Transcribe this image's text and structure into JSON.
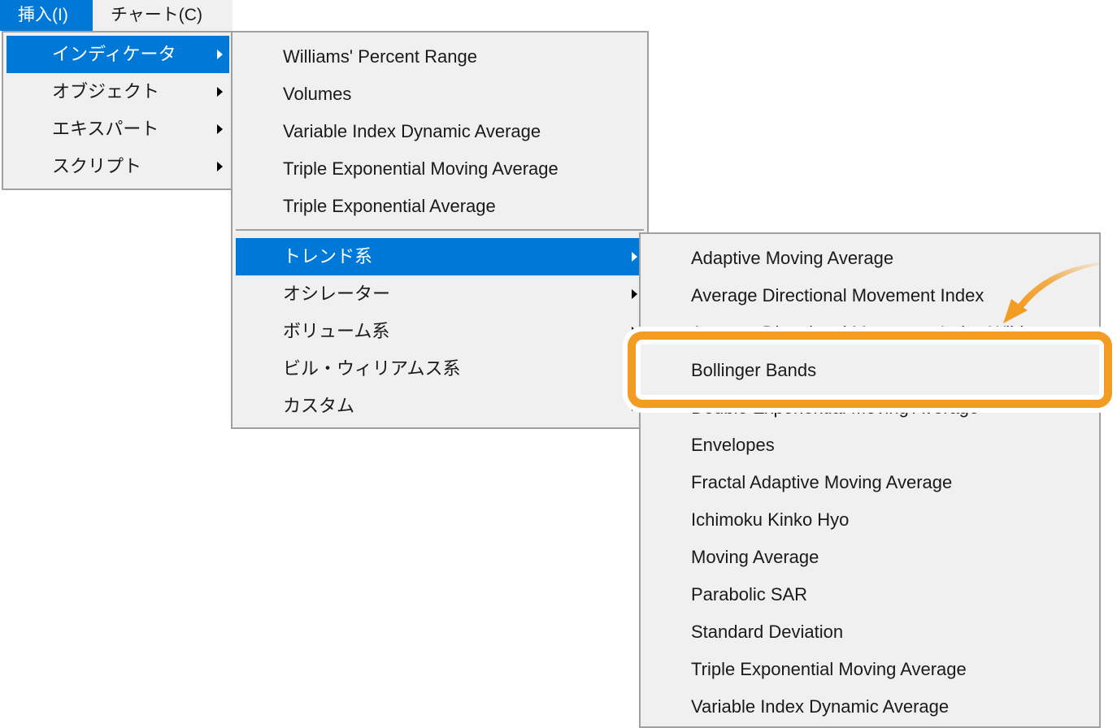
{
  "menubar": {
    "items": [
      {
        "label": "挿入(I)",
        "active": true
      },
      {
        "label": "チャート(C)",
        "active": false
      }
    ]
  },
  "insert_menu": {
    "items": [
      {
        "label": "インディケータ",
        "submenu": true,
        "selected": true
      },
      {
        "label": "オブジェクト",
        "submenu": true,
        "selected": false
      },
      {
        "label": "エキスパート",
        "submenu": true,
        "selected": false
      },
      {
        "label": "スクリプト",
        "submenu": true,
        "selected": false
      }
    ]
  },
  "indicators_menu": {
    "items": [
      {
        "label": "Williams' Percent Range"
      },
      {
        "label": "Volumes"
      },
      {
        "label": "Variable Index Dynamic Average"
      },
      {
        "label": "Triple Exponential Moving Average"
      },
      {
        "label": "Triple Exponential Average"
      }
    ],
    "categories": [
      {
        "label": "トレンド系",
        "submenu": true,
        "selected": true
      },
      {
        "label": "オシレーター",
        "submenu": true,
        "selected": false
      },
      {
        "label": "ボリューム系",
        "submenu": true,
        "selected": false
      },
      {
        "label": "ビル・ウィリアムス系",
        "submenu": true,
        "selected": false
      },
      {
        "label": "カスタム",
        "submenu": true,
        "selected": false
      }
    ]
  },
  "trend_menu": {
    "items": [
      {
        "label": "Adaptive Moving Average"
      },
      {
        "label": "Average Directional Movement Index"
      },
      {
        "label": "Average Directional Movement Index Wilder"
      },
      {
        "label": "Bollinger Bands",
        "highlighted": true
      },
      {
        "label": "Double Exponential Moving Average"
      },
      {
        "label": "Envelopes"
      },
      {
        "label": "Fractal Adaptive Moving Average"
      },
      {
        "label": "Ichimoku Kinko Hyo"
      },
      {
        "label": "Moving Average"
      },
      {
        "label": "Parabolic SAR"
      },
      {
        "label": "Standard Deviation"
      },
      {
        "label": "Triple Exponential Moving Average"
      },
      {
        "label": "Variable Index Dynamic Average"
      }
    ]
  },
  "annotation": {
    "color": "#f39c23",
    "target": "Bollinger Bands"
  },
  "colors": {
    "selection": "#0078d7",
    "menu_bg": "#f0f0f0",
    "border": "#a0a0a0"
  }
}
